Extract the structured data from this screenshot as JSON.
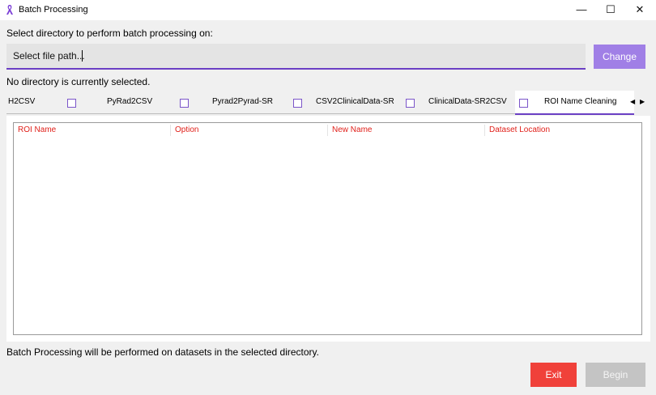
{
  "window": {
    "title": "Batch Processing",
    "controls": {
      "minimize": "—",
      "maximize": "☐",
      "close": "✕"
    },
    "icon": "ribbon-icon"
  },
  "directory": {
    "label": "Select directory to perform batch processing on:",
    "path_placeholder": "Select file path...",
    "change_label": "Change",
    "status": "No directory is currently selected."
  },
  "tabs": {
    "items": [
      {
        "label": "H2CSV",
        "checked": false
      },
      {
        "label": "PyRad2CSV",
        "checked": false
      },
      {
        "label": "Pyrad2Pyrad-SR",
        "checked": false
      },
      {
        "label": "CSV2ClinicalData-SR",
        "checked": false
      },
      {
        "label": "ClinicalData-SR2CSV",
        "checked": false
      },
      {
        "label": "ROI Name Cleaning",
        "active": true
      }
    ],
    "scroll_left": "◀",
    "scroll_right": "▶"
  },
  "table": {
    "columns": [
      "ROI Name",
      "Option",
      "New Name",
      "Dataset Location"
    ],
    "rows": []
  },
  "footer": {
    "info": "Batch Processing will be performed on datasets in the selected directory.",
    "exit_label": "Exit",
    "begin_label": "Begin"
  },
  "colors": {
    "accent": "#6b3fc4",
    "change_button": "#a07fe6",
    "exit_button": "#f0413a",
    "begin_button_disabled": "#c4c4c4",
    "header_text": "#e0201a"
  }
}
